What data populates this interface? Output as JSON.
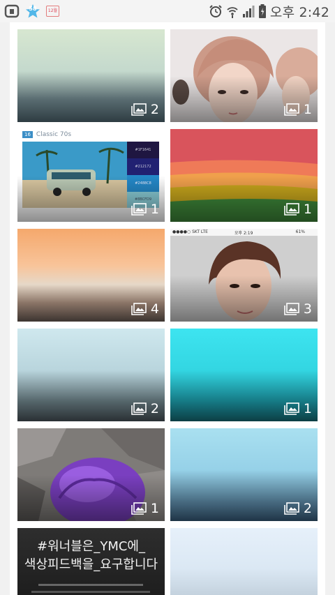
{
  "status_bar": {
    "notification_count": "58",
    "calendar_label": "12월",
    "time": "오후 2:42"
  },
  "grid": [
    {
      "count": "2"
    },
    {
      "count": "1"
    },
    {
      "count": "1",
      "header": "Classic 70s",
      "header_num": "16",
      "swatches": [
        "#1F1641",
        "#212172",
        "#2488C8",
        "#8BCFD9"
      ]
    },
    {
      "count": "1"
    },
    {
      "count": "4"
    },
    {
      "count": "3",
      "status": {
        "carrier": "●●●●○ SKT  LTE",
        "time": "오후 2:19",
        "battery": "61%"
      }
    },
    {
      "count": "2"
    },
    {
      "count": "1"
    },
    {
      "count": "1"
    },
    {
      "count": "2"
    },
    {
      "lines": [
        "#워너블은_YMC에_",
        "색상피드백을_요구합니다"
      ]
    },
    {}
  ],
  "colors": {
    "accent": "#52b7e8",
    "background": "#f1f1f1"
  }
}
